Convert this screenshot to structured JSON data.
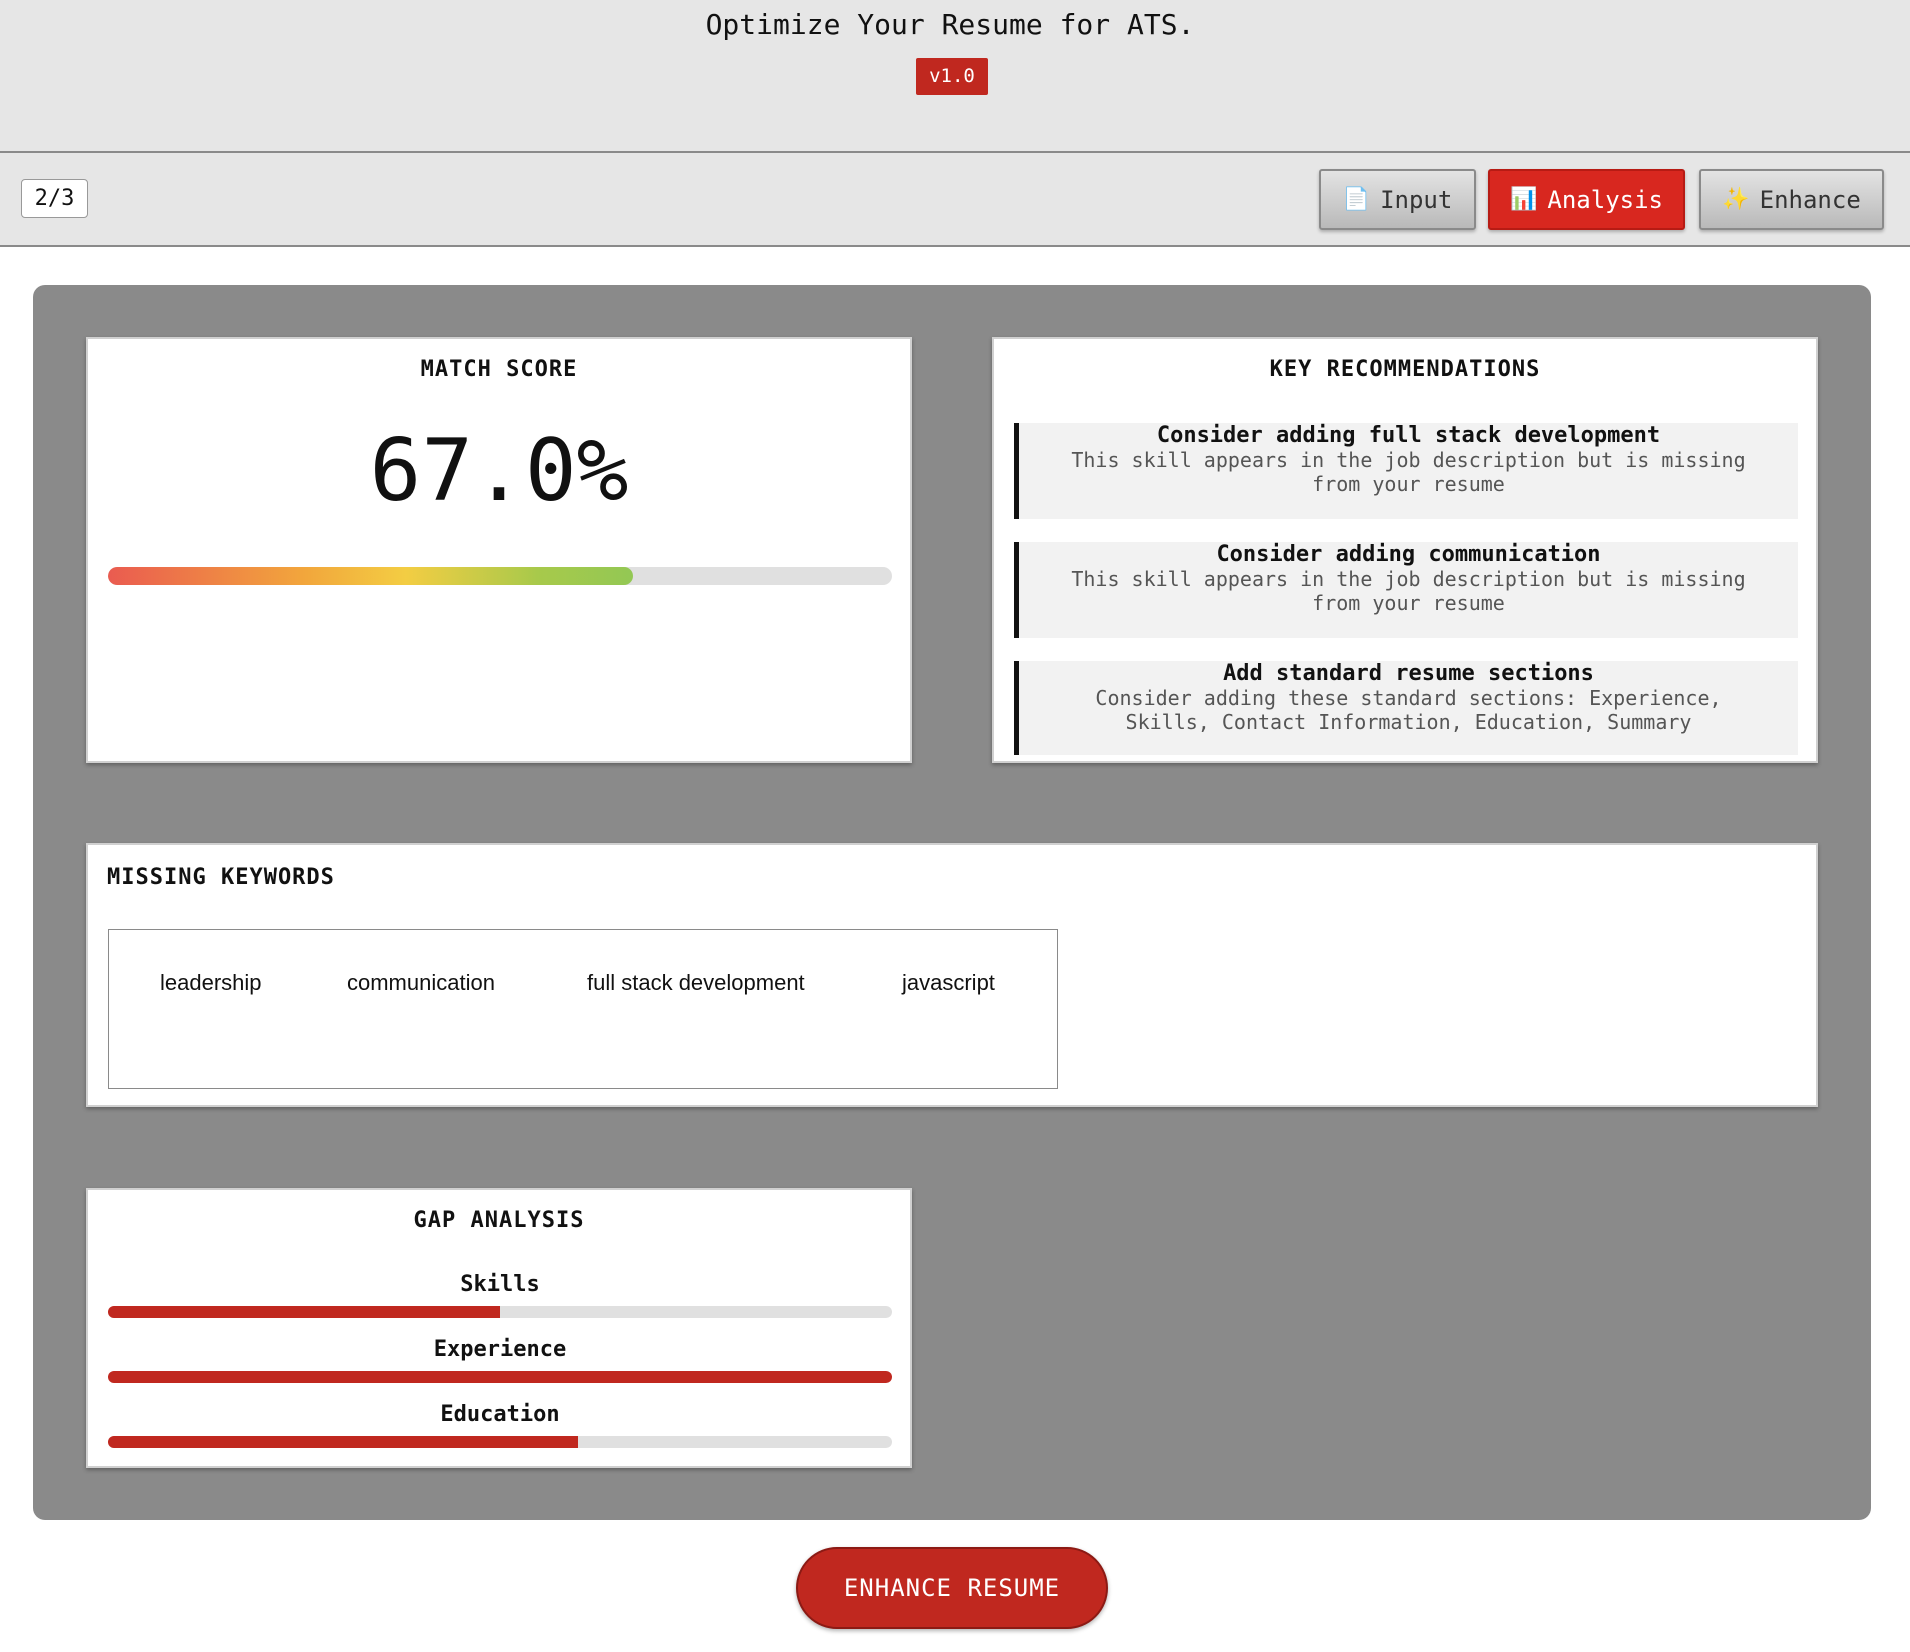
{
  "header": {
    "title": "Optimize Your Resume for ATS.",
    "version": "v1.0"
  },
  "toolbar": {
    "step": "2/3",
    "tabs": [
      {
        "label": "Input",
        "icon": "document-icon",
        "glyph": "📄",
        "active": false
      },
      {
        "label": "Analysis",
        "icon": "bar-chart-icon",
        "glyph": "📊",
        "active": true
      },
      {
        "label": "Enhance",
        "icon": "sparkles-icon",
        "glyph": "✨",
        "active": false
      }
    ]
  },
  "match_score": {
    "title": "MATCH SCORE",
    "value_text": "67.0%",
    "value": 67.0
  },
  "recommendations": {
    "title": "KEY RECOMMENDATIONS",
    "items": [
      {
        "title": "Consider adding full stack development",
        "description": "This skill appears in the job description but is missing from your resume"
      },
      {
        "title": "Consider adding communication",
        "description": "This skill appears in the job description but is missing from your resume"
      },
      {
        "title": "Add standard resume sections",
        "description": "Consider adding these standard sections: Experience, Skills, Contact Information, Education, Summary"
      }
    ]
  },
  "missing_keywords": {
    "title": "MISSING KEYWORDS",
    "items": [
      "leadership",
      "communication",
      "full stack development",
      "javascript"
    ]
  },
  "gap_analysis": {
    "title": "GAP ANALYSIS",
    "rows": [
      {
        "label": "Skills",
        "fraction": 0.5
      },
      {
        "label": "Experience",
        "fraction": 1.0
      },
      {
        "label": "Education",
        "fraction": 0.6
      }
    ]
  },
  "actions": {
    "enhance_label": "ENHANCE RESUME"
  },
  "colors": {
    "accent": "#c0281f",
    "panel": "#8a8a8a",
    "header_bg": "#e6e6e6"
  }
}
